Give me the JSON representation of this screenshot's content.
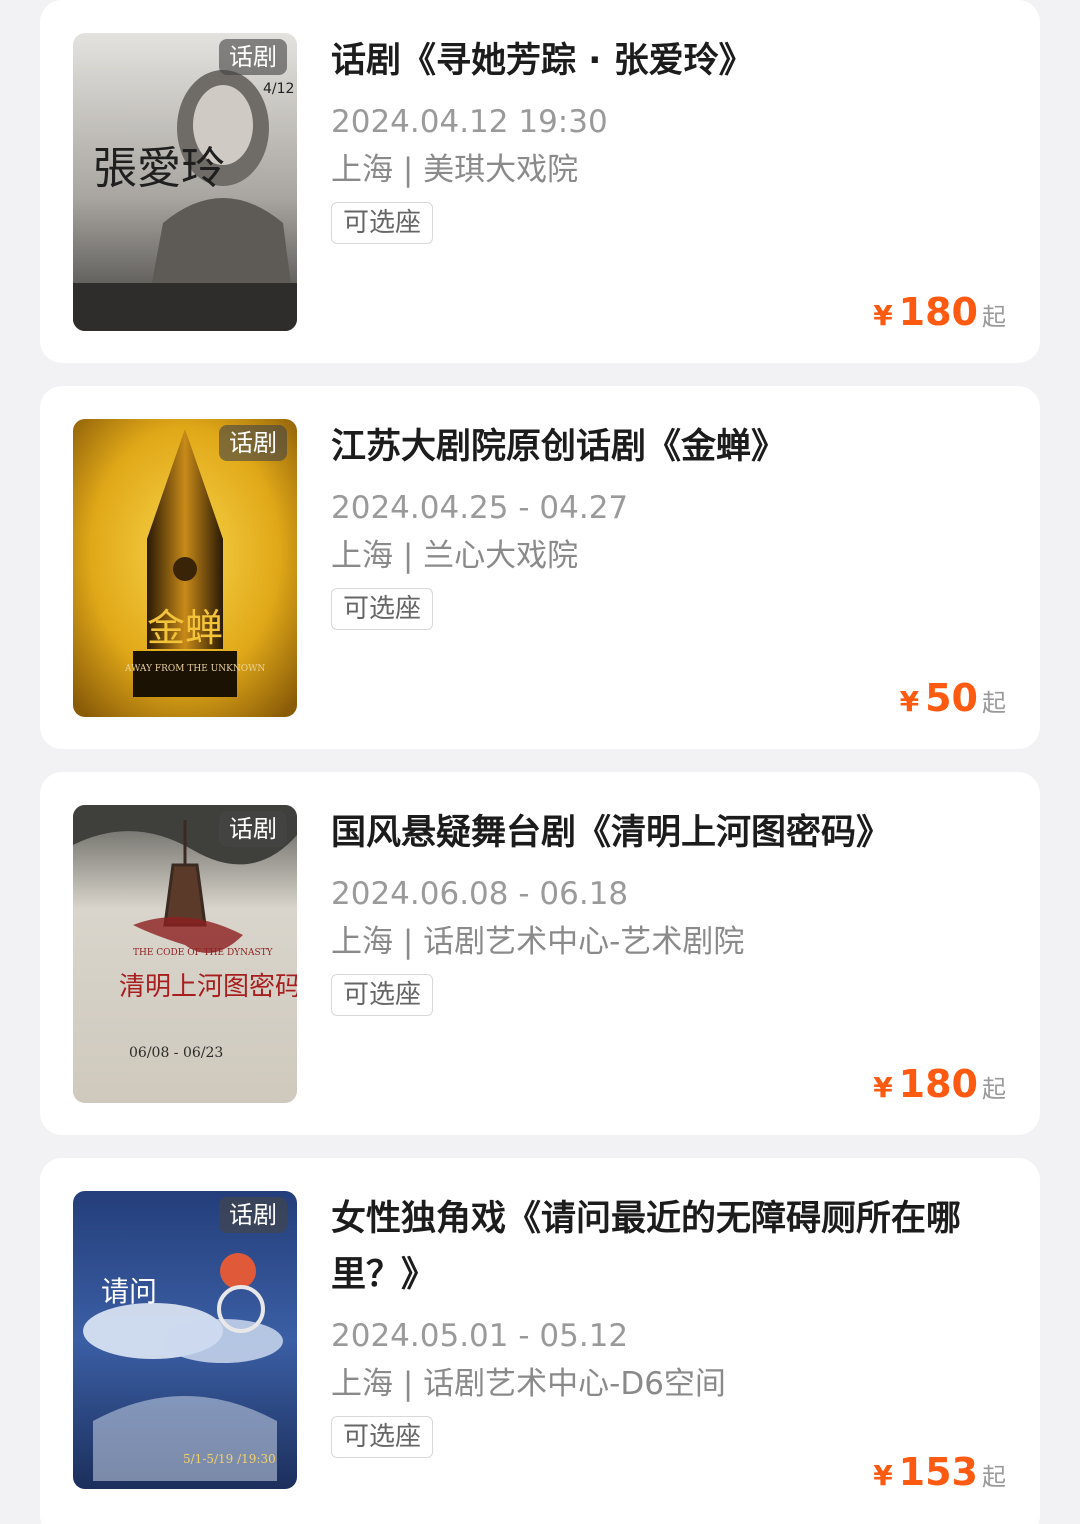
{
  "events": [
    {
      "tag": "话剧",
      "title": "话剧《寻她芳踪 · 张爱玲》",
      "date": "2024.04.12 19:30",
      "venue": "上海 | 美琪大戏院",
      "seat": "可选座",
      "currency": "¥",
      "price": "180",
      "price_suffix": "起",
      "poster_text": "張愛玲",
      "poster_date": "4/12"
    },
    {
      "tag": "话剧",
      "title": "江苏大剧院原创话剧《金蝉》",
      "date": "2024.04.25 - 04.27",
      "venue": "上海 | 兰心大戏院",
      "seat": "可选座",
      "currency": "¥",
      "price": "50",
      "price_suffix": "起",
      "poster_text": "金蝉",
      "poster_subtext": "AWAY FROM THE UNKNOWN"
    },
    {
      "tag": "话剧",
      "title": "国风悬疑舞台剧《清明上河图密码》",
      "date": "2024.06.08 - 06.18",
      "venue": "上海 | 话剧艺术中心-艺术剧院",
      "seat": "可选座",
      "currency": "¥",
      "price": "180",
      "price_suffix": "起",
      "poster_text": "清明上河图密码",
      "poster_subtext": "THE CODE OF THE DYNASTY",
      "poster_date": "06/08 - 06/23"
    },
    {
      "tag": "话剧",
      "title": "女性独角戏《请问最近的无障碍厕所在哪里？》",
      "date": "2024.05.01 - 05.12",
      "venue": "上海 | 话剧艺术中心-D6空间",
      "seat": "可选座",
      "currency": "¥",
      "price": "153",
      "price_suffix": "起",
      "poster_text": "请问",
      "poster_date": "5/1-5/19 /19:30"
    }
  ],
  "colors": {
    "price": "#ff5a12",
    "background": "#f2f2f4",
    "card": "#ffffff"
  }
}
